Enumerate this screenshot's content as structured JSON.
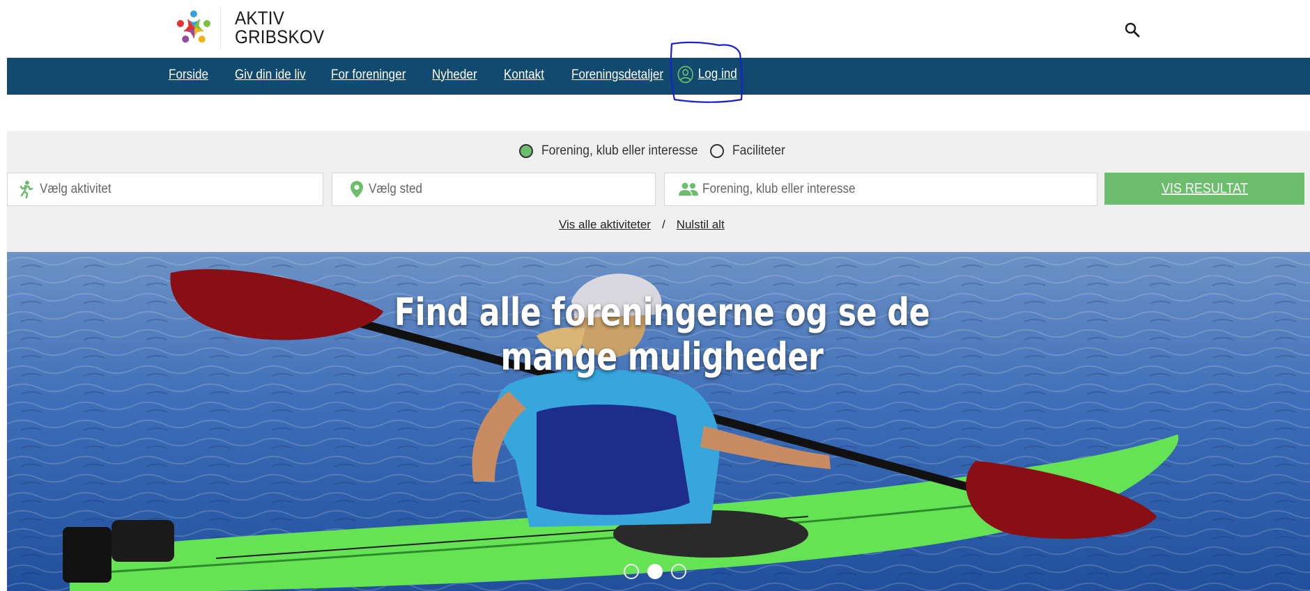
{
  "header": {
    "logo_line1": "AKTIV",
    "logo_line2": "GRIBSKOV"
  },
  "nav": {
    "items": [
      "Forside",
      "Giv din ide liv",
      "For foreninger",
      "Nyheder",
      "Kontakt",
      "Foreningsdetaljer"
    ],
    "login_label": "Log ind"
  },
  "search": {
    "radio_options": [
      {
        "label": "Forening, klub eller interesse",
        "selected": true
      },
      {
        "label": "Faciliteter",
        "selected": false
      }
    ],
    "activity_placeholder": "Vælg aktivitet",
    "place_placeholder": "Vælg sted",
    "association_placeholder": "Forening, klub eller interesse",
    "submit_label": "VIS RESULTAT",
    "show_all_label": "Vis alle aktiviteter",
    "separator": "/",
    "reset_label": "Nulstil alt"
  },
  "hero": {
    "title": "Find alle foreningerne og se de mange muligheder",
    "slides": 3,
    "active_slide": 2
  },
  "colors": {
    "nav_bg": "#114a6e",
    "accent_green": "#6cbd6e",
    "panel_bg": "#f0f0f0",
    "annotation": "#1a22c9"
  }
}
